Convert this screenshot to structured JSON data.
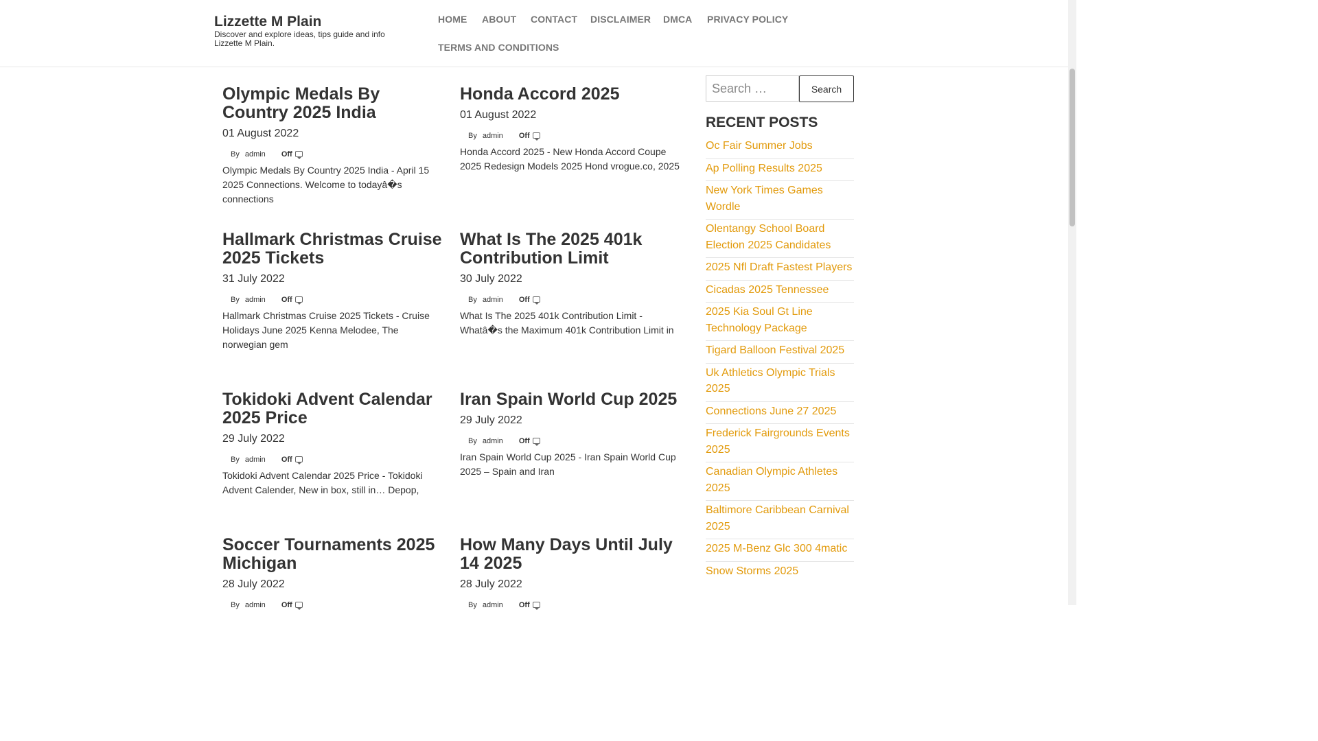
{
  "site": {
    "title": "Lizzette M Plain",
    "description": "Discover and explore ideas, tips guide and info Lizzette M Plain."
  },
  "nav": {
    "items": [
      "HOME",
      "ABOUT",
      "CONTACT",
      "DISCLAIMER",
      "DMCA",
      "PRIVACY POLICY",
      "TERMS AND CONDITIONS"
    ]
  },
  "posts": [
    {
      "title": "Olympic Medals By Country 2025 India",
      "date": "01 August 2022",
      "by": "By",
      "author": "admin",
      "comments": "Off",
      "excerpt": "Olympic Medals By Country 2025 India - April 15 2025 Connections. Welcome to todayâ�s connections"
    },
    {
      "title": "Honda Accord 2025",
      "date": "01 August 2022",
      "by": "By",
      "author": "admin",
      "comments": "Off",
      "excerpt": "Honda Accord 2025 - New Honda Accord Coupe 2025 Redesign Models 2025 Hond vrogue.co, 2025"
    },
    {
      "title": "Hallmark Christmas Cruise 2025 Tickets",
      "date": "31 July 2022",
      "by": "By",
      "author": "admin",
      "comments": "Off",
      "excerpt": "Hallmark Christmas Cruise 2025 Tickets - Cruise Holidays June 2025 Kenna Melodee, The norwegian gem"
    },
    {
      "title": "What Is The 2025 401k Contribution Limit",
      "date": "30 July 2022",
      "by": "By",
      "author": "admin",
      "comments": "Off",
      "excerpt": "What Is The 2025 401k Contribution Limit - Whatâ�s the Maximum 401k Contribution Limit in"
    },
    {
      "title": "Tokidoki Advent Calendar 2025 Price",
      "date": "29 July 2022",
      "by": "By",
      "author": "admin",
      "comments": "Off",
      "excerpt": "Tokidoki Advent Calendar 2025 Price - Tokidoki Advent Calender, New in box, still in… Depop,"
    },
    {
      "title": "Iran Spain World Cup 2025",
      "date": "29 July 2022",
      "by": "By",
      "author": "admin",
      "comments": "Off",
      "excerpt": "Iran Spain World Cup 2025 - Iran Spain World Cup 2025 – Spain and Iran"
    },
    {
      "title": "Soccer Tournaments 2025 Michigan",
      "date": "28 July 2022",
      "by": "By",
      "author": "admin",
      "comments": "Off",
      "excerpt": ""
    },
    {
      "title": "How Many Days Until July 14 2025",
      "date": "28 July 2022",
      "by": "By",
      "author": "admin",
      "comments": "Off",
      "excerpt": ""
    }
  ],
  "sidebar": {
    "search_placeholder": "Search …",
    "search_button": "Search",
    "recent_title": "RECENT POSTS",
    "recent_posts": [
      "Oc Fair Summer Jobs",
      "Ap Polling Results 2025",
      "New York Times Games Wordle",
      "Olentangy School Board Election 2025 Candidates",
      "2025 Nfl Draft Fastest Players",
      "Cicadas 2025 Tennessee",
      "2025 Kia Soul Gt Line Technology Package",
      "Tigard Balloon Festival 2025",
      "Uk Athletics Olympic Trials 2025",
      "Connections June 27 2025",
      "Frederick Fairgrounds Events 2025",
      "Canadian Olympic Athletes 2025",
      "Baltimore Caribbean Carnival 2025",
      "2025 M-Benz Glc 300 4matic",
      "Snow Storms 2025"
    ]
  },
  "colors": {
    "link_accent": "#e29a0b",
    "nav_text": "#777777",
    "body_text": "#333333"
  }
}
